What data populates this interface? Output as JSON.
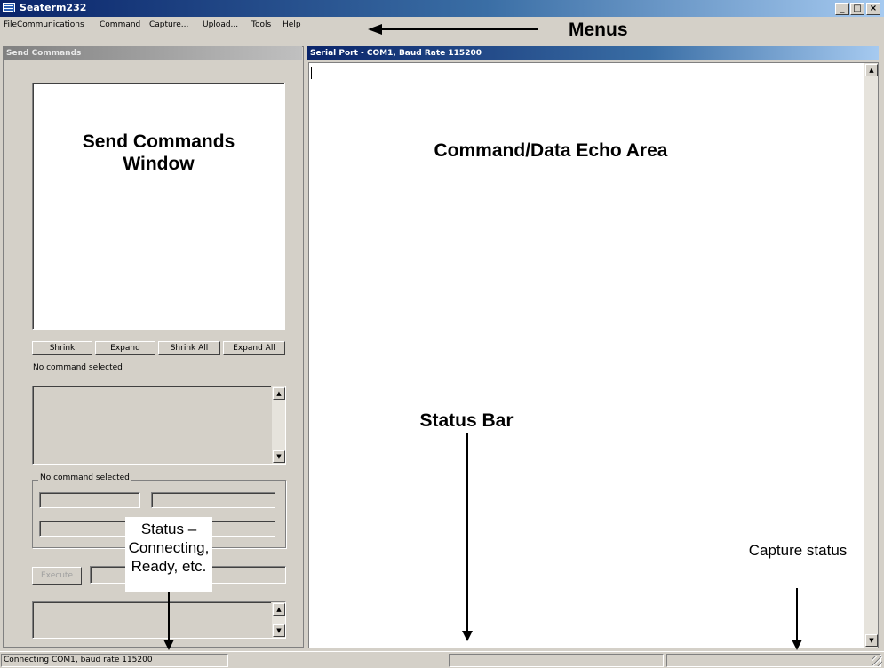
{
  "window": {
    "title": "Seaterm232"
  },
  "menu": {
    "items": [
      "File",
      "Communications",
      "Command",
      "Capture...",
      "Upload...",
      "Tools",
      "Help"
    ]
  },
  "left_panel": {
    "header": "Send Commands",
    "buttons": [
      "Shrink",
      "Expand",
      "Shrink All",
      "Expand All"
    ],
    "no_command_text": "No command selected",
    "group_label": "No command selected",
    "execute_label": "Execute"
  },
  "right_panel": {
    "header": "Serial Port - COM1, Baud Rate 115200"
  },
  "statusbar": {
    "connection": "Connecting COM1, baud rate 115200",
    "middle": "",
    "capture": ""
  },
  "annotations": {
    "menus": "Menus",
    "send_commands_window": "Send Commands Window",
    "echo_area": "Command/Data Echo Area",
    "status_bar": "Status Bar",
    "status_callout": "Status – Connecting, Ready, etc.",
    "capture_status": "Capture status"
  }
}
